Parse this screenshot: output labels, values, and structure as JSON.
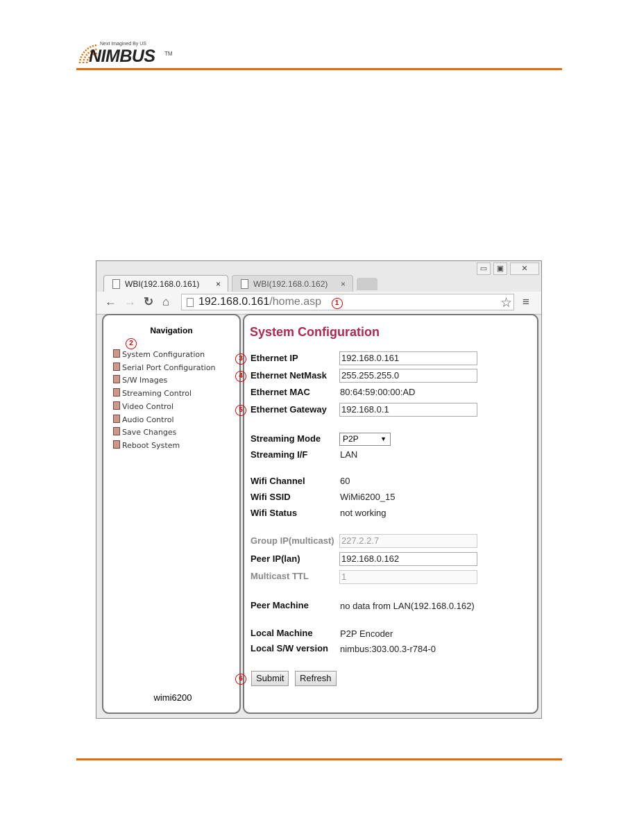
{
  "logo": {
    "tagline": "Next Imagined By US",
    "name": "NIMBUS",
    "tm": "TM"
  },
  "brand_color": "#e36c0a",
  "browser": {
    "tabs": [
      {
        "label": "WBI(192.168.0.161)",
        "close": "×"
      },
      {
        "label": "WBI(192.168.0.162)",
        "close": "×"
      }
    ],
    "url_host": "192.168.0.161",
    "url_path": "/home.asp",
    "window_buttons": [
      "▭",
      "▣",
      "✕"
    ]
  },
  "markers": [
    "1",
    "2",
    "3",
    "4",
    "5",
    "6"
  ],
  "nav": {
    "title": "Navigation",
    "items": [
      "System Configuration",
      "Serial Port Configuration",
      "S/W Images",
      "Streaming Control",
      "Video Control",
      "Audio Control",
      "Save Changes",
      "Reboot System"
    ],
    "footer": "wimi6200"
  },
  "main": {
    "title": "System Configuration",
    "title_color": "#b0284e",
    "ethernet_ip": {
      "label": "Ethernet IP",
      "value": "192.168.0.161"
    },
    "netmask": {
      "label": "Ethernet NetMask",
      "value": "255.255.255.0"
    },
    "mac": {
      "label": "Ethernet MAC",
      "value": "80:64:59:00:00:AD"
    },
    "gateway": {
      "label": "Ethernet Gateway",
      "value": "192.168.0.1"
    },
    "streaming_mode": {
      "label": "Streaming Mode",
      "value": "P2P"
    },
    "streaming_if": {
      "label": "Streaming I/F",
      "value": "LAN"
    },
    "wifi_channel": {
      "label": "Wifi Channel",
      "value": "60"
    },
    "wifi_ssid": {
      "label": "Wifi SSID",
      "value": "WiMi6200_15"
    },
    "wifi_status": {
      "label": "Wifi Status",
      "value": "not working"
    },
    "group_ip": {
      "label": "Group IP(multicast)",
      "value": "227.2.2.7"
    },
    "peer_ip": {
      "label": "Peer IP(lan)",
      "value": "192.168.0.162"
    },
    "ttl": {
      "label": "Multicast TTL",
      "value": "1"
    },
    "peer_machine": {
      "label": "Peer Machine",
      "value": "no data from LAN(192.168.0.162)"
    },
    "local_machine": {
      "label": "Local Machine",
      "value": "P2P Encoder"
    },
    "local_sw": {
      "label": "Local S/W version",
      "value": "nimbus:303.00.3-r784-0"
    },
    "submit": "Submit",
    "refresh": "Refresh"
  }
}
